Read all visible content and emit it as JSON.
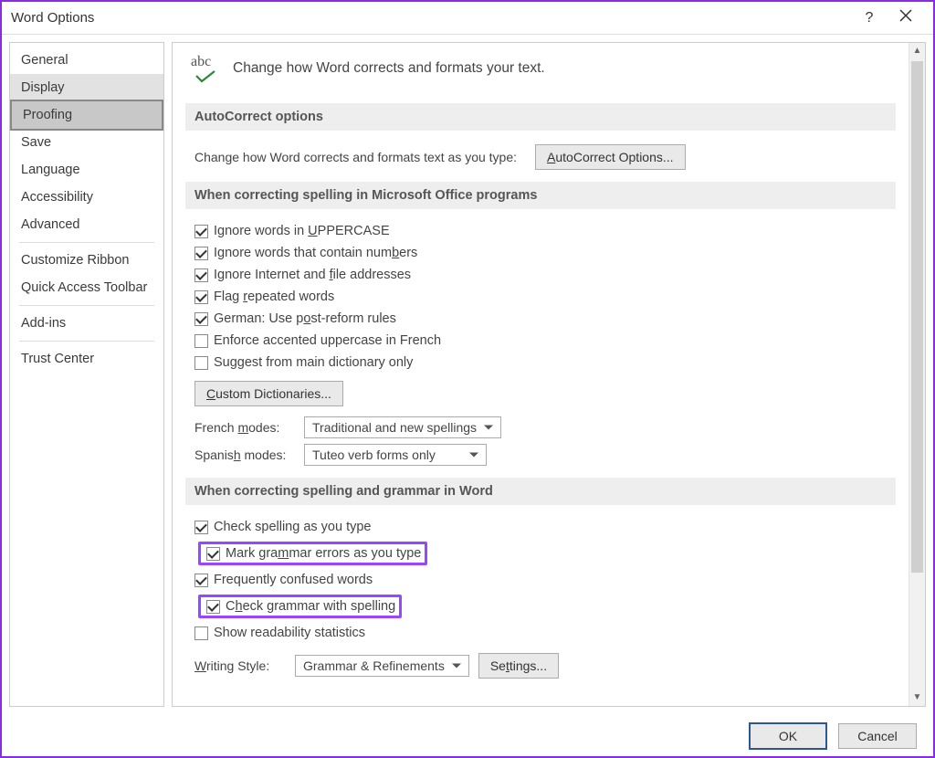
{
  "window": {
    "title": "Word Options"
  },
  "sidebar": {
    "items": [
      "General",
      "Display",
      "Proofing",
      "Save",
      "Language",
      "Accessibility",
      "Advanced",
      "Customize Ribbon",
      "Quick Access Toolbar",
      "Add-ins",
      "Trust Center"
    ],
    "selected": "Proofing",
    "hover": "Display"
  },
  "header": {
    "headline": "Change how Word corrects and formats your text."
  },
  "sections": {
    "autocorrect": {
      "title": "AutoCorrect options",
      "desc": "Change how Word corrects and formats text as you type:",
      "button": "AutoCorrect Options..."
    },
    "office_spelling": {
      "title": "When correcting spelling in Microsoft Office programs",
      "checks": [
        {
          "label_parts": [
            "Ignore words in ",
            "U",
            "PPERCASE"
          ],
          "checked": true
        },
        {
          "label_parts": [
            "Ignore words that contain num",
            "b",
            "ers"
          ],
          "checked": true
        },
        {
          "label_parts": [
            "Ignore Internet and ",
            "f",
            "ile addresses"
          ],
          "checked": true
        },
        {
          "label_parts": [
            "Flag ",
            "r",
            "epeated words"
          ],
          "checked": true
        },
        {
          "label_parts": [
            "German: Use p",
            "o",
            "st-reform rules"
          ],
          "checked": true
        },
        {
          "label_parts": [
            "Enforce accented uppercase in French"
          ],
          "checked": false
        },
        {
          "label_parts": [
            "Suggest from main dictionary only"
          ],
          "checked": false
        }
      ],
      "custom_dict_btn": "Custom Dictionaries...",
      "french_label": "French modes:",
      "french_value": "Traditional and new spellings",
      "spanish_label": "Spanish modes:",
      "spanish_value": "Tuteo verb forms only"
    },
    "word_spelling": {
      "title": "When correcting spelling and grammar in Word",
      "checks": [
        {
          "label": "Check spelling as you type",
          "checked": true,
          "hl": false,
          "und": ""
        },
        {
          "label": "Mark grammar errors as you type",
          "checked": true,
          "hl": true,
          "und": "m",
          "pre": "Mark gra",
          "post": "mar errors as you type"
        },
        {
          "label": "Frequently confused words",
          "checked": true,
          "hl": false,
          "und": ""
        },
        {
          "label": "Check grammar with spelling",
          "checked": true,
          "hl": true,
          "und": "h",
          "pre": "C",
          "post": "eck grammar with spelling"
        },
        {
          "label": "Show readability statistics",
          "checked": false,
          "hl": false,
          "und": ""
        }
      ],
      "writing_style_label": "Writing Style:",
      "writing_style_value": "Grammar & Refinements",
      "settings_btn": "Settings..."
    }
  },
  "footer": {
    "ok": "OK",
    "cancel": "Cancel"
  }
}
